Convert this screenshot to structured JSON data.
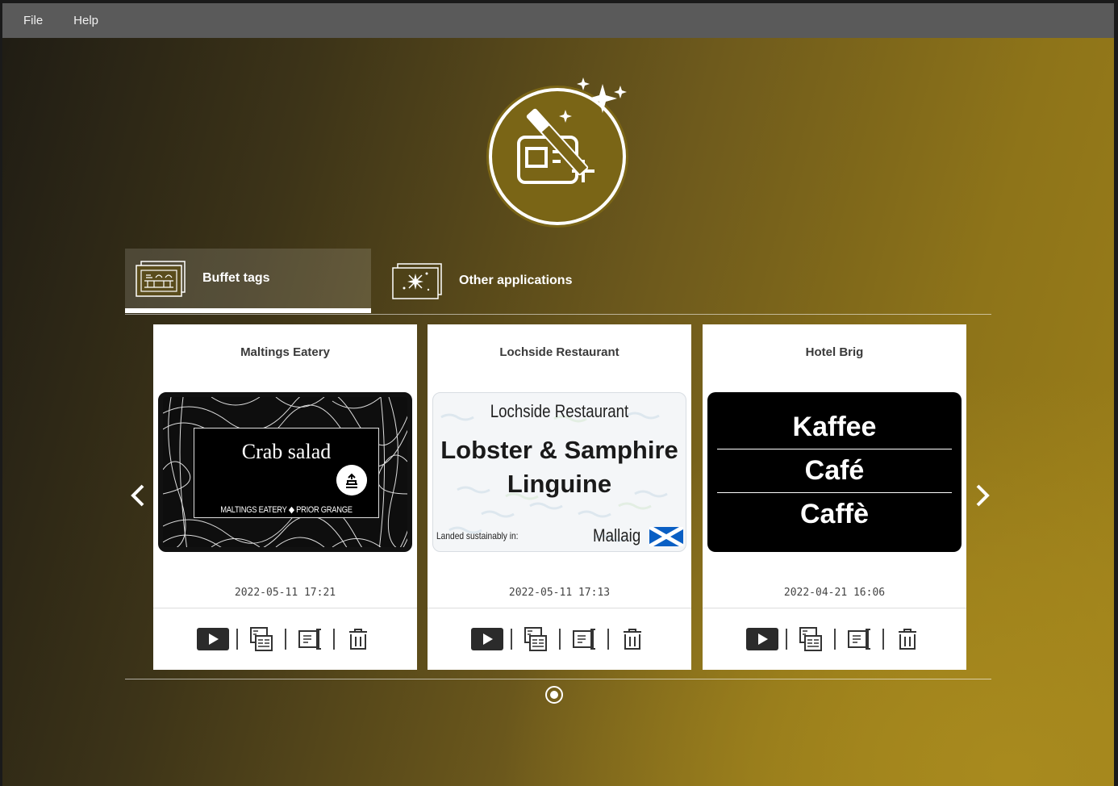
{
  "menu": {
    "file": "File",
    "help": "Help"
  },
  "tabs": [
    {
      "label": "Buffet tags",
      "icon": "buffet-icon",
      "active": true
    },
    {
      "label": "Other applications",
      "icon": "sparkle-icon",
      "active": false
    }
  ],
  "cards": [
    {
      "title": "Maltings Eatery",
      "date": "2022-05-11 17:21",
      "thumb": {
        "dish": "Crab salad",
        "footer_left": "MALTINGS EATERY",
        "footer_sep": "◆",
        "footer_right": "PRIOR GRANGE"
      }
    },
    {
      "title": "Lochside Restaurant",
      "date": "2022-05-11 17:13",
      "thumb": {
        "brand": "Lochside Restaurant",
        "dish_line1": "Lobster & Samphire",
        "dish_line2": "Linguine",
        "landed": "Landed sustainably in:",
        "place": "Mallaig"
      }
    },
    {
      "title": "Hotel Brig",
      "date": "2022-04-21 16:06",
      "thumb": {
        "line1": "Kaffee",
        "line2": "Café",
        "line3": "Caffè"
      }
    }
  ],
  "actions": [
    "play-icon",
    "edit-layout-icon",
    "rename-icon",
    "trash-icon"
  ],
  "colors": {
    "menubar": "#5a5a5a",
    "accent": "#7a6516"
  }
}
